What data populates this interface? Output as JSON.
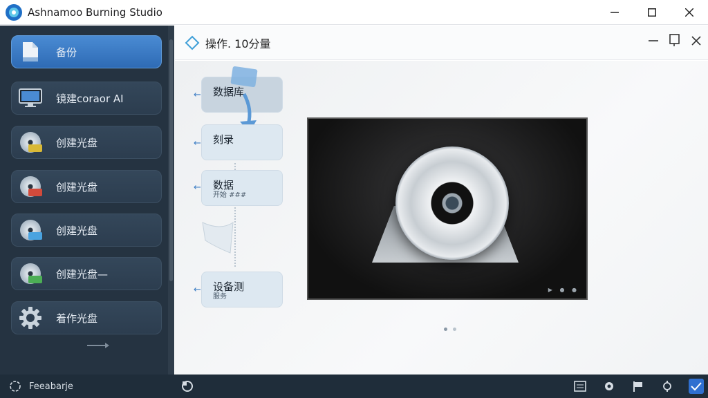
{
  "window": {
    "title": "Ashnamoo Burning Studio"
  },
  "sidebar": {
    "items": [
      {
        "label": "备份"
      },
      {
        "label": "镜建coraor AI"
      },
      {
        "label": "创建光盘"
      },
      {
        "label": "创建光盘"
      },
      {
        "label": "创建光盘"
      },
      {
        "label": "创建光盘—"
      },
      {
        "label": "着作光盘"
      }
    ]
  },
  "panel": {
    "title": "操作. 10分量",
    "steps": [
      {
        "label": "数据库",
        "sub": ""
      },
      {
        "label": "刻录",
        "sub": ""
      },
      {
        "label": "数据",
        "sub": "开始 ###"
      },
      {
        "label": "设备测",
        "sub": "服务"
      }
    ]
  },
  "statusbar": {
    "feedback_label": "Feeabarje"
  },
  "colors": {
    "sidebar_bg": "#253341",
    "accent": "#3f7fc5",
    "statusbar_bg": "#1f2d3a"
  }
}
